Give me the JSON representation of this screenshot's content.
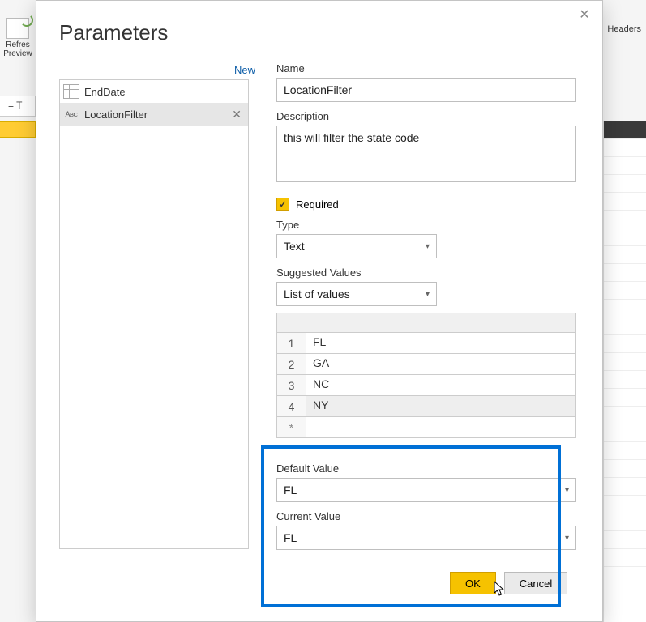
{
  "background": {
    "refresh_label": "Refres\nPreview",
    "headers_label": "Headers ",
    "fx_text": "= T"
  },
  "dialog": {
    "title": "Parameters",
    "new_label": "New"
  },
  "param_list": [
    {
      "icon": "table",
      "label": "EndDate",
      "selected": false
    },
    {
      "icon": "abc",
      "label": "LocationFilter",
      "selected": true
    }
  ],
  "form": {
    "name_label": "Name",
    "name_value": "LocationFilter",
    "desc_label": "Description",
    "desc_value": "this will filter the state code",
    "required_label": "Required",
    "type_label": "Type",
    "type_value": "Text",
    "sugg_label": "Suggested Values",
    "sugg_value": "List of values",
    "values": [
      {
        "n": "1",
        "v": "FL"
      },
      {
        "n": "2",
        "v": "GA"
      },
      {
        "n": "3",
        "v": "NC"
      },
      {
        "n": "4",
        "v": "NY"
      }
    ],
    "new_row_marker": "*",
    "default_label": "Default Value",
    "default_value": "FL",
    "current_label": "Current Value",
    "current_value": "FL"
  },
  "buttons": {
    "ok": "OK",
    "cancel": "Cancel"
  }
}
